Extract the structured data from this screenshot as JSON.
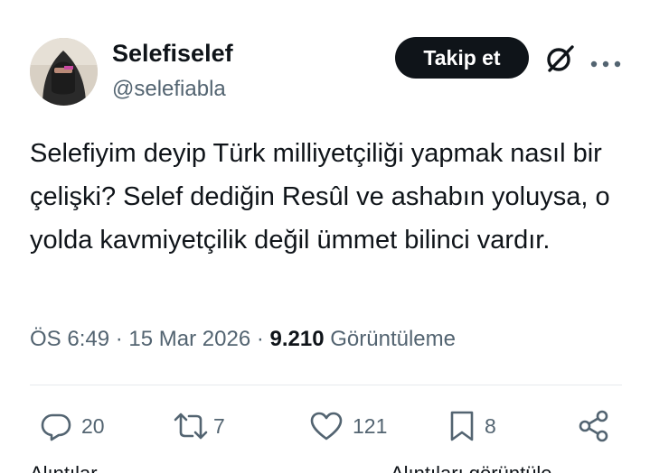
{
  "author": {
    "display_name": "Selefiselef",
    "handle": "@selefiabla",
    "avatar_icon": "avatar-niqab-photo"
  },
  "header": {
    "follow_label": "Takip et",
    "grok_icon": "grok-icon",
    "more_icon": "more-dots-icon"
  },
  "tweet": {
    "text": "Selefiyim deyip Türk milliyetçiliği yapmak nasıl bir çelişki? Selef dediğin Resûl ve ashabın yoluysa, o yolda kavmiyetçilik değil ümmet bilinci vardır."
  },
  "meta": {
    "time": "ÖS 6:49",
    "separator": "·",
    "date": "15 Mar 2026",
    "views_count": "9.210",
    "views_label": "Görüntüleme"
  },
  "actions": {
    "replies": "20",
    "reposts": "7",
    "likes": "121",
    "bookmarks": "8"
  },
  "footer": {
    "left_partial": "Alıntılar",
    "right_partial": "Alıntıları görüntüle"
  },
  "colors": {
    "text": "#0f1419",
    "secondary": "#536471",
    "button_bg": "#0f1419",
    "divider": "#e6eaed"
  }
}
